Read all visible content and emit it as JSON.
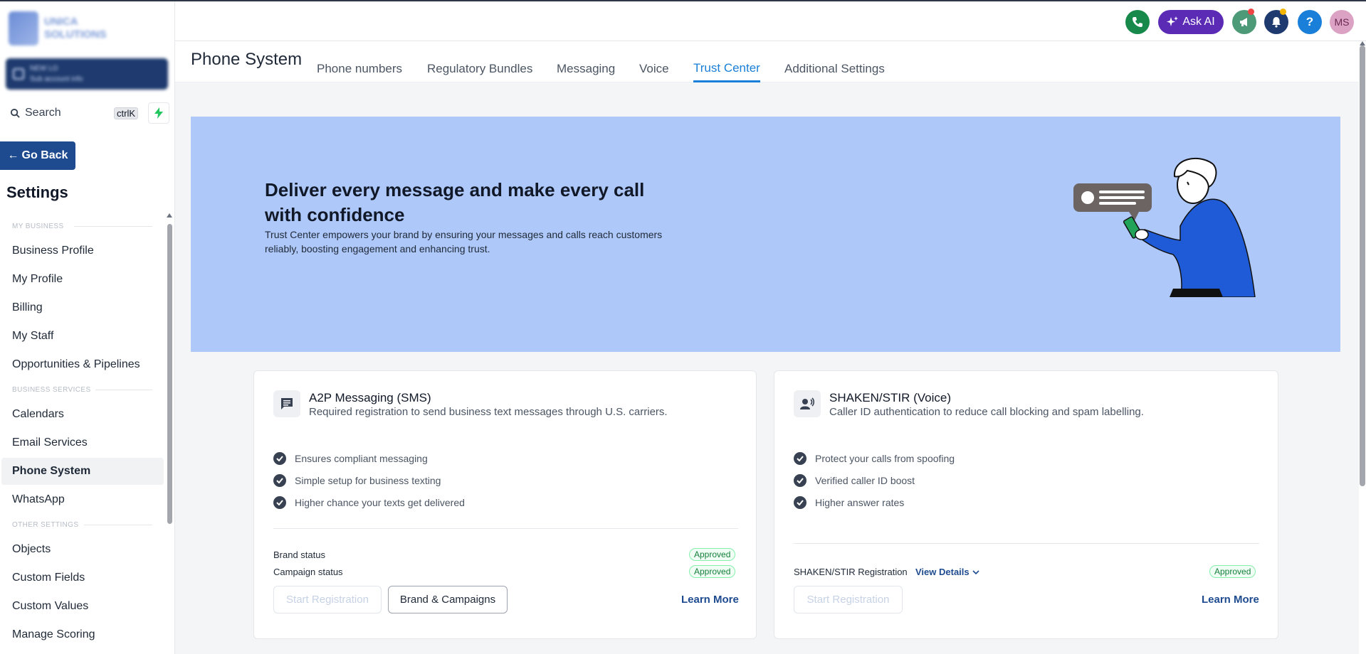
{
  "sidebar": {
    "logo_text": [
      "UNICA",
      "SOLUTIONS"
    ],
    "account": {
      "name": "NEW LO",
      "sub": "Sub account info"
    },
    "search": {
      "label": "Search",
      "shortcut": "ctrlK"
    },
    "go_back": "Go Back",
    "settings_title": "Settings",
    "sections": {
      "my_business": "MY BUSINESS",
      "business_services": "BUSINESS SERVICES",
      "other_settings": "OTHER SETTINGS"
    },
    "items": {
      "business_profile": "Business Profile",
      "my_profile": "My Profile",
      "billing": "Billing",
      "my_staff": "My Staff",
      "opportunities": "Opportunities & Pipelines",
      "calendars": "Calendars",
      "email_services": "Email Services",
      "phone_system": "Phone System",
      "whatsapp": "WhatsApp",
      "objects": "Objects",
      "custom_fields": "Custom Fields",
      "custom_values": "Custom Values",
      "manage_scoring": "Manage Scoring"
    }
  },
  "topbar": {
    "ask_ai": "Ask AI",
    "help": "?",
    "avatar_initials": "MS"
  },
  "header": {
    "title": "Phone System",
    "tabs": {
      "phone_numbers": "Phone numbers",
      "regulatory_bundles": "Regulatory Bundles",
      "messaging": "Messaging",
      "voice": "Voice",
      "trust_center": "Trust Center",
      "additional_settings": "Additional Settings"
    },
    "active_tab": "Trust Center"
  },
  "hero": {
    "title": "Deliver every message and make every call with confidence",
    "subtitle": "Trust Center empowers your brand by ensuring your messages and calls reach customers reliably, boosting engagement and enhancing trust."
  },
  "a2p_card": {
    "title": "A2P Messaging (SMS)",
    "description": "Required registration to send business text messages through U.S. carriers.",
    "features": [
      "Ensures compliant messaging",
      "Simple setup for business texting",
      "Higher chance your texts get delivered"
    ],
    "brand_status_label": "Brand status",
    "brand_status": "Approved",
    "campaign_status_label": "Campaign status",
    "campaign_status": "Approved",
    "start_registration": "Start Registration",
    "brand_campaigns": "Brand & Campaigns",
    "learn_more": "Learn More"
  },
  "shaken_card": {
    "title": "SHAKEN/STIR (Voice)",
    "description": "Caller ID authentication to reduce call blocking and spam labelling.",
    "features": [
      "Protect your calls from spoofing",
      "Verified caller ID boost",
      "Higher answer rates"
    ],
    "registration_label": "SHAKEN/STIR Registration",
    "view_details": "View Details",
    "registration_status": "Approved",
    "start_registration": "Start Registration",
    "learn_more": "Learn More"
  },
  "colors": {
    "accent": "#1a7fd8",
    "primary_dark": "#1e4b8f",
    "hero_bg": "#aec8f9",
    "ask_ai": "#5b2bb6",
    "phone": "#17894b",
    "approved": "#15803d"
  }
}
